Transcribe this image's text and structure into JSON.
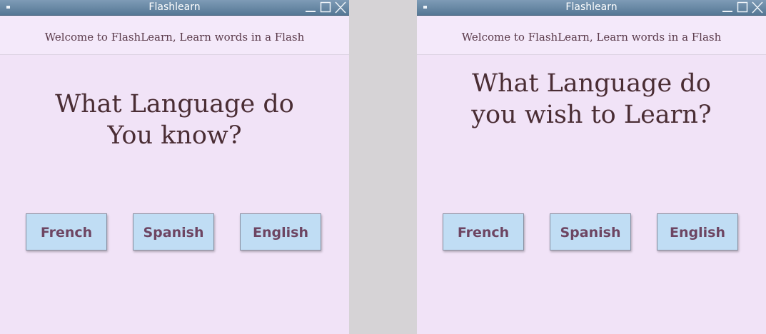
{
  "windows": [
    {
      "title": "Flashlearn",
      "welcome": "Welcome to FlashLearn, Learn words in a Flash",
      "question_line1": "What Language do",
      "question_line2": "You know?",
      "buttons": [
        "French",
        "Spanish",
        "English"
      ]
    },
    {
      "title": "Flashlearn",
      "welcome": "Welcome to FlashLearn, Learn words in a Flash",
      "question_line1": "What Language do",
      "question_line2": "you wish to Learn?",
      "buttons": [
        "French",
        "Spanish",
        "English"
      ]
    }
  ],
  "colors": {
    "background": "#f1e3f7",
    "titlebar": "#6b8aa7",
    "button": "#c0ddf4",
    "button_text": "#6d4562",
    "question_text": "#4a2d34"
  },
  "icons": {
    "window_menu": "window-menu-icon",
    "minimize": "minimize-icon",
    "maximize": "maximize-icon",
    "close": "close-icon"
  }
}
